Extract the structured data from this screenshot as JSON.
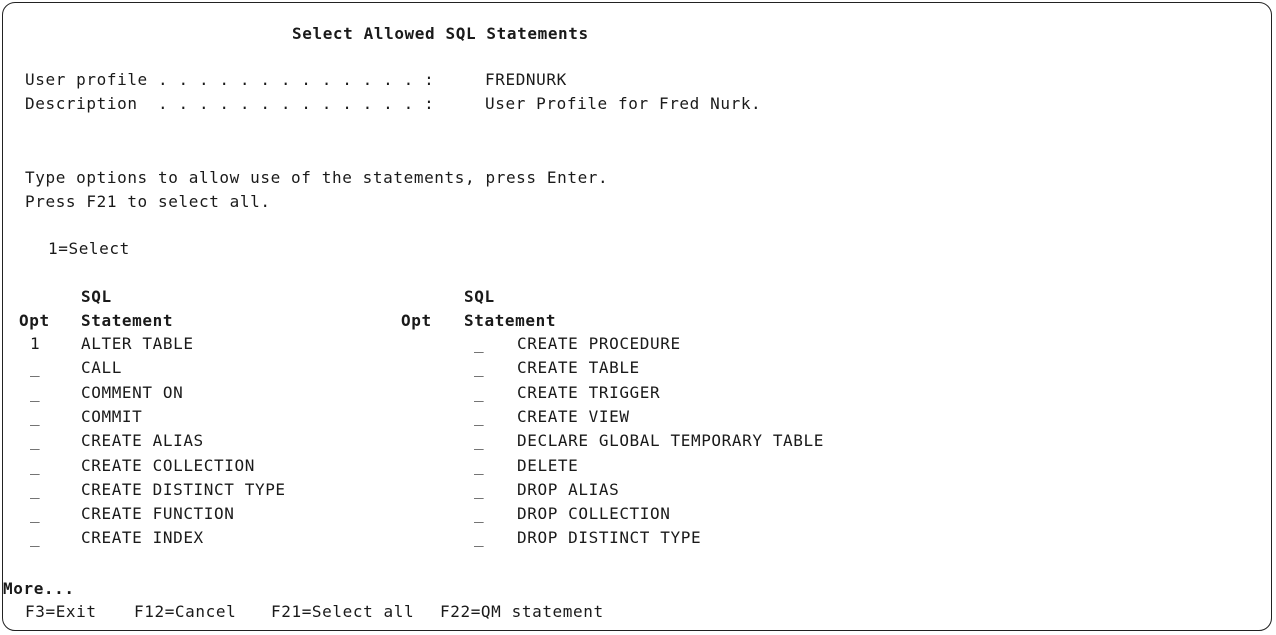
{
  "screen": {
    "title": "Select Allowed SQL Statements",
    "user_profile_label": "User profile . . . . . . . . . . . . . :",
    "user_profile_value": "FREDNURK",
    "description_label": "Description  . . . . . . . . . . . . . :",
    "description_value": "User Profile for Fred Nurk.",
    "instructions_line1": "Type options to allow use of the statements, press Enter.",
    "instructions_line2": "Press F21 to select all.",
    "option_legend": "1=Select",
    "header_sql": "SQL",
    "header_opt": "Opt",
    "header_statement": "Statement",
    "more": "More...",
    "left_column": [
      {
        "opt": "1",
        "statement": "ALTER TABLE"
      },
      {
        "opt": "_",
        "statement": "CALL"
      },
      {
        "opt": "_",
        "statement": "COMMENT ON"
      },
      {
        "opt": "_",
        "statement": "COMMIT"
      },
      {
        "opt": "_",
        "statement": "CREATE ALIAS"
      },
      {
        "opt": "_",
        "statement": "CREATE COLLECTION"
      },
      {
        "opt": "_",
        "statement": "CREATE DISTINCT TYPE"
      },
      {
        "opt": "_",
        "statement": "CREATE FUNCTION"
      },
      {
        "opt": "_",
        "statement": "CREATE INDEX"
      }
    ],
    "right_column": [
      {
        "opt": "_",
        "statement": "CREATE PROCEDURE"
      },
      {
        "opt": "_",
        "statement": "CREATE TABLE"
      },
      {
        "opt": "_",
        "statement": "CREATE TRIGGER"
      },
      {
        "opt": "_",
        "statement": "CREATE VIEW"
      },
      {
        "opt": "_",
        "statement": "DECLARE GLOBAL TEMPORARY TABLE"
      },
      {
        "opt": "_",
        "statement": "DELETE"
      },
      {
        "opt": "_",
        "statement": "DROP ALIAS"
      },
      {
        "opt": "_",
        "statement": "DROP COLLECTION"
      },
      {
        "opt": "_",
        "statement": "DROP DISTINCT TYPE"
      }
    ],
    "function_keys": {
      "f3": "F3=Exit",
      "f12": "F12=Cancel",
      "f21": "F21=Select all",
      "f22": "F22=QM statement"
    }
  }
}
